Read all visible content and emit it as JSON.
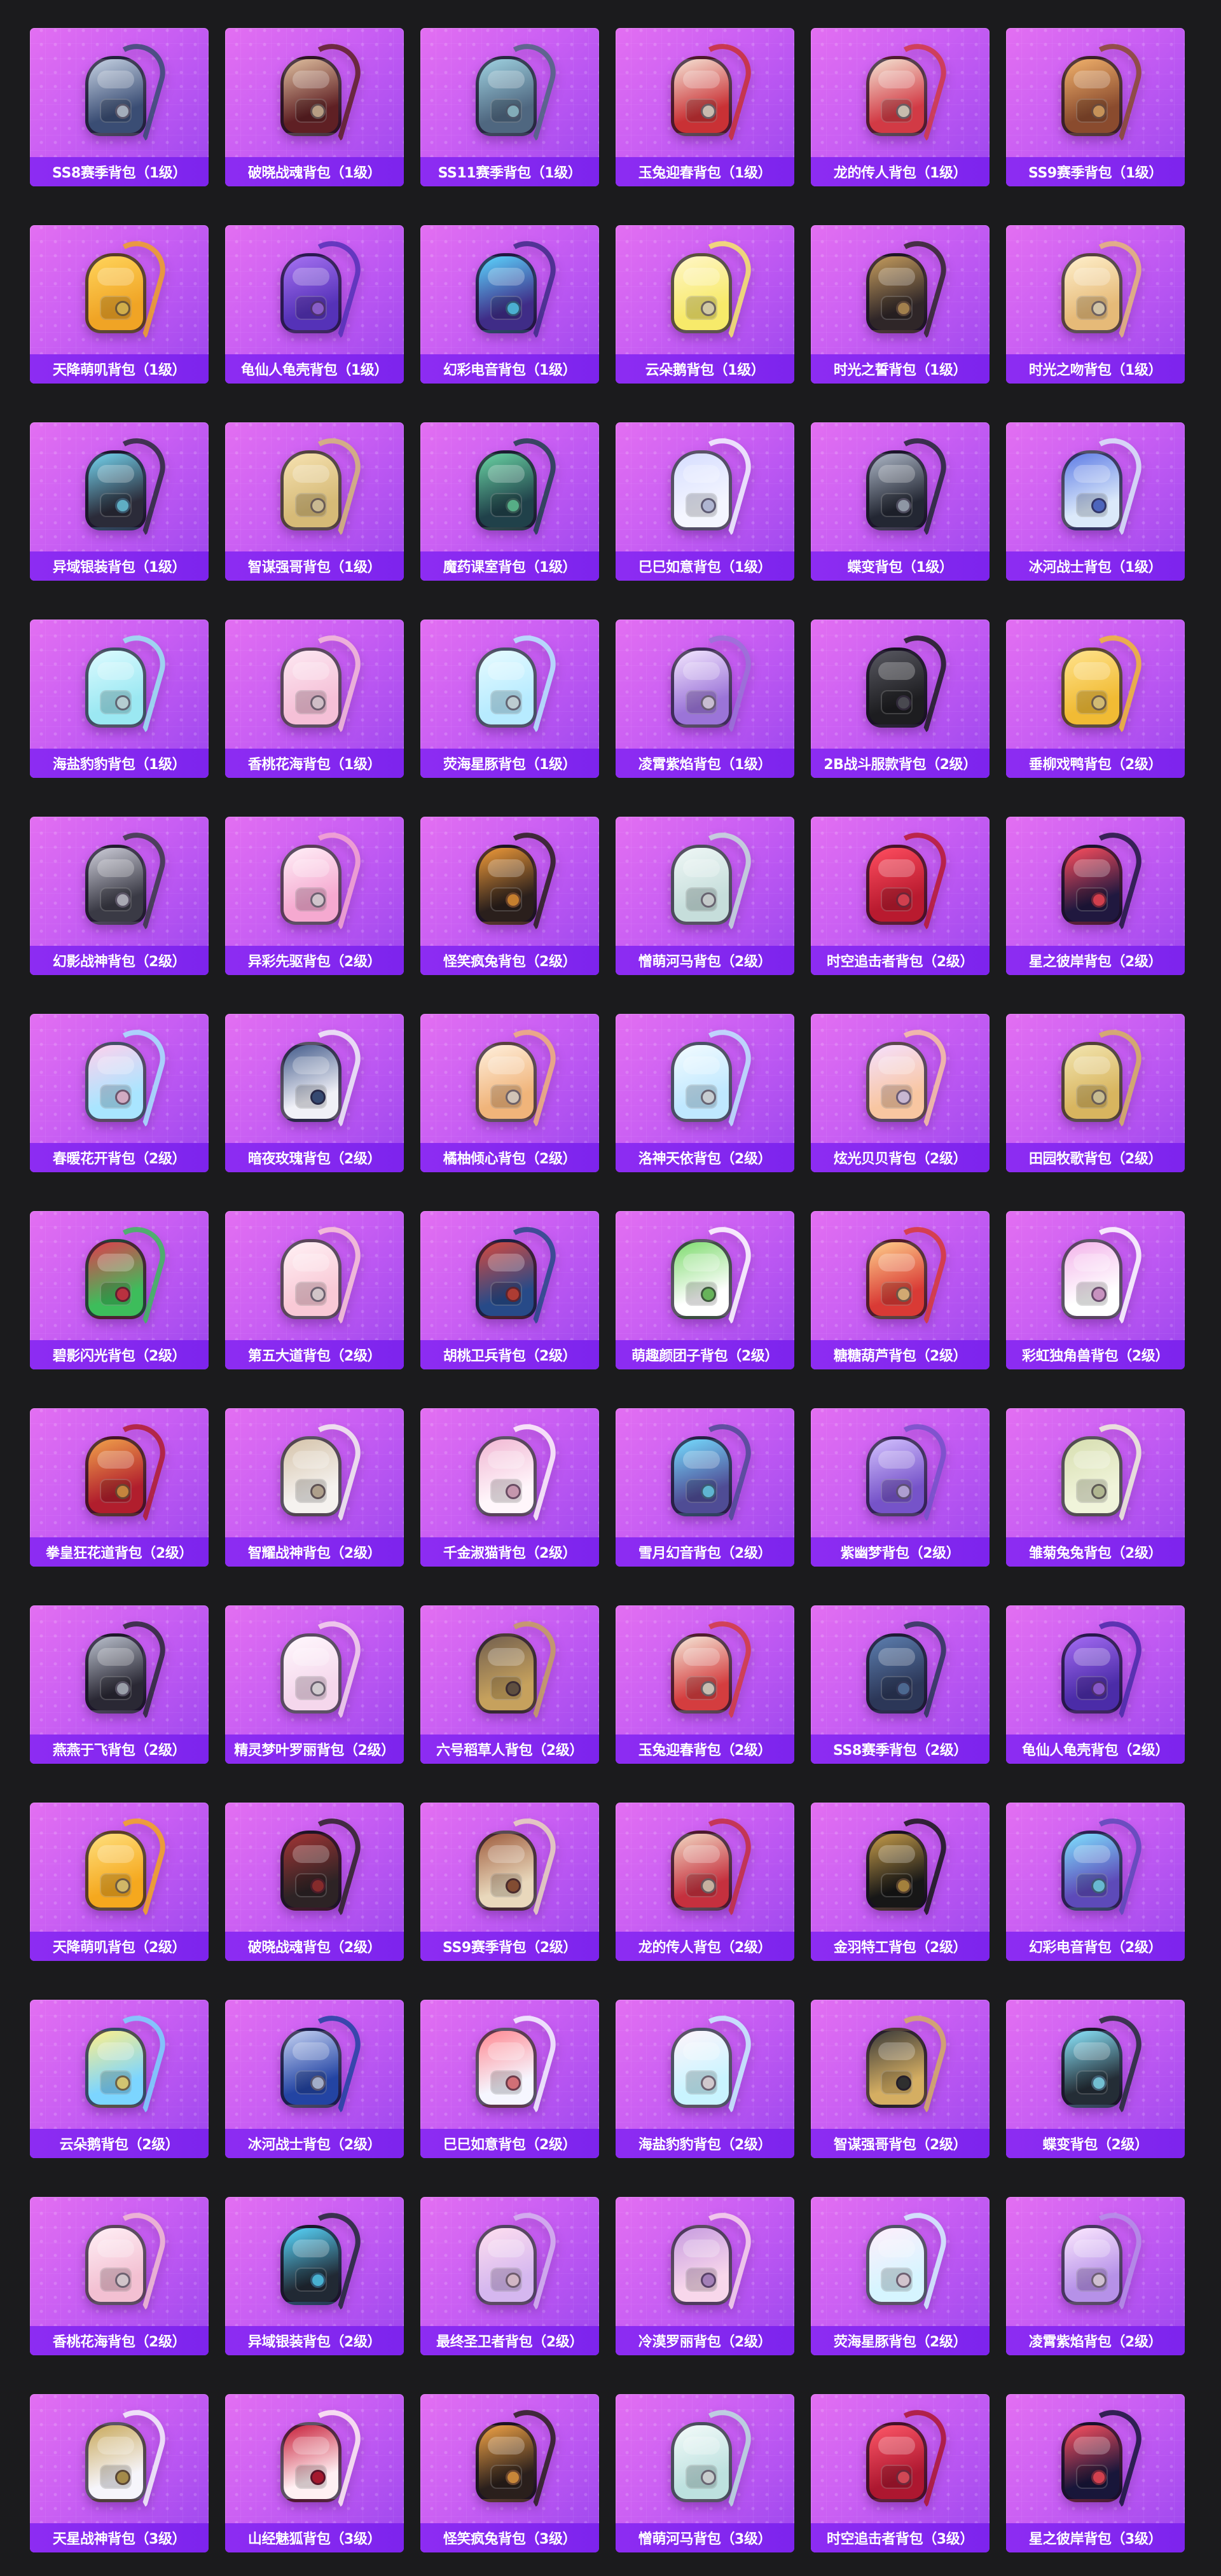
{
  "items": [
    {
      "name": "SS8赛季背包（1级）",
      "icon": "backpack-icon",
      "colors": [
        "#3a4d74",
        "#c7d3e4"
      ]
    },
    {
      "name": "破晓战魂背包（1级）",
      "icon": "backpack-icon",
      "colors": [
        "#5f2024",
        "#e0c0a0"
      ]
    },
    {
      "name": "SS11赛季背包（1级）",
      "icon": "backpack-icon",
      "colors": [
        "#4f6780",
        "#9fd2e1"
      ]
    },
    {
      "name": "玉兔迎春背包（1级）",
      "icon": "backpack-icon",
      "colors": [
        "#c93135",
        "#f6e4d6"
      ]
    },
    {
      "name": "龙的传人背包（1级）",
      "icon": "backpack-icon",
      "colors": [
        "#d23a45",
        "#f4e4d3"
      ]
    },
    {
      "name": "SS9赛季背包（1级）",
      "icon": "backpack-icon",
      "colors": [
        "#8a4b2e",
        "#f2b26c"
      ]
    },
    {
      "name": "天降萌叽背包（1级）",
      "icon": "backpack-icon",
      "colors": [
        "#f0a425",
        "#ffd55c"
      ]
    },
    {
      "name": "龟仙人龟壳背包（1级）",
      "icon": "backpack-icon",
      "colors": [
        "#5532b8",
        "#a772f3"
      ]
    },
    {
      "name": "幻彩电音背包（1级）",
      "icon": "backpack-icon",
      "colors": [
        "#3f2c87",
        "#5cd6ff"
      ]
    },
    {
      "name": "云朵鹅背包（1级）",
      "icon": "backpack-icon",
      "colors": [
        "#f7ea6a",
        "#fff6c8"
      ]
    },
    {
      "name": "时光之誓背包（1级）",
      "icon": "backpack-icon",
      "colors": [
        "#2f2628",
        "#c69d5e"
      ]
    },
    {
      "name": "时光之吻背包（1级）",
      "icon": "backpack-icon",
      "colors": [
        "#e6ba78",
        "#fff0cc"
      ]
    },
    {
      "name": "异域银装背包（1级）",
      "icon": "backpack-icon",
      "colors": [
        "#2b2b39",
        "#74d5f0"
      ]
    },
    {
      "name": "智谋强哥背包（1级）",
      "icon": "backpack-icon",
      "colors": [
        "#d6ba77",
        "#f6e2b1"
      ]
    },
    {
      "name": "魔药课室背包（1级）",
      "icon": "backpack-icon",
      "colors": [
        "#20414a",
        "#6ad4a4"
      ]
    },
    {
      "name": "巳巳如意背包（1级）",
      "icon": "backpack-icon",
      "colors": [
        "#f4f6ff",
        "#d6ddff"
      ]
    },
    {
      "name": "蝶变背包（1级）",
      "icon": "backpack-icon",
      "colors": [
        "#232733",
        "#aeb8c8"
      ]
    },
    {
      "name": "冰河战士背包（1级）",
      "icon": "backpack-icon",
      "colors": [
        "#dbe9fa",
        "#5e7ce6"
      ]
    },
    {
      "name": "海盐豹豹背包（1级）",
      "icon": "backpack-icon",
      "colors": [
        "#9be8f2",
        "#ddfbff"
      ]
    },
    {
      "name": "香桃花海背包（1级）",
      "icon": "backpack-icon",
      "colors": [
        "#f5c0d7",
        "#fde8f2"
      ]
    },
    {
      "name": "荧海星豚背包（1级）",
      "icon": "backpack-icon",
      "colors": [
        "#b7ebff",
        "#e7fbff"
      ]
    },
    {
      "name": "凌霄紫焰背包（1级）",
      "icon": "backpack-icon",
      "colors": [
        "#9b74d8",
        "#f4e7ff"
      ]
    },
    {
      "name": "2B战斗服款背包（2级）",
      "icon": "backpack-icon",
      "colors": [
        "#1d1d20",
        "#595962"
      ]
    },
    {
      "name": "垂柳戏鸭背包（2级）",
      "icon": "backpack-icon",
      "colors": [
        "#f1bb34",
        "#ffe38d"
      ]
    },
    {
      "name": "幻影战神背包（2级）",
      "icon": "backpack-icon",
      "colors": [
        "#3a3a45",
        "#cfcfdb"
      ]
    },
    {
      "name": "异彩先驱背包（2级）",
      "icon": "backpack-icon",
      "colors": [
        "#f5a9d0",
        "#fff0f8"
      ]
    },
    {
      "name": "怪笑疯兔背包（2级）",
      "icon": "backpack-icon",
      "colors": [
        "#2a1f1c",
        "#f19b39"
      ]
    },
    {
      "name": "憎萌河马背包（2级）",
      "icon": "backpack-icon",
      "colors": [
        "#c6dedb",
        "#eff7f6"
      ]
    },
    {
      "name": "时空追击者背包（2级）",
      "icon": "backpack-icon",
      "colors": [
        "#b91a2f",
        "#ff4e60"
      ]
    },
    {
      "name": "星之彼岸背包（2级）",
      "icon": "backpack-icon",
      "colors": [
        "#20183f",
        "#ff4e5e"
      ]
    },
    {
      "name": "春暖花开背包（2级）",
      "icon": "backpack-icon",
      "colors": [
        "#a9e5ff",
        "#ffd1ed"
      ]
    },
    {
      "name": "暗夜玫瑰背包（2级）",
      "icon": "backpack-icon",
      "colors": [
        "#f0f0f7",
        "#425a8a"
      ]
    },
    {
      "name": "橘柚倾心背包（2级）",
      "icon": "backpack-icon",
      "colors": [
        "#f0b47a",
        "#fff0de"
      ]
    },
    {
      "name": "洛神天依背包（2级）",
      "icon": "backpack-icon",
      "colors": [
        "#bfe8ff",
        "#f3fbff"
      ]
    },
    {
      "name": "炫光贝贝背包（2级）",
      "icon": "backpack-icon",
      "colors": [
        "#f8c6a1",
        "#f5e0ff"
      ]
    },
    {
      "name": "田园牧歌背包（2级）",
      "icon": "backpack-icon",
      "colors": [
        "#d8b55f",
        "#f3e6b1"
      ]
    },
    {
      "name": "碧影闪光背包（2级）",
      "icon": "backpack-icon",
      "colors": [
        "#3dbd5b",
        "#e23c4d"
      ]
    },
    {
      "name": "第五大道背包（2级）",
      "icon": "backpack-icon",
      "colors": [
        "#f9c9d6",
        "#fff1f5"
      ]
    },
    {
      "name": "胡桃卫兵背包（2级）",
      "icon": "backpack-icon",
      "colors": [
        "#274a88",
        "#d54a3f"
      ]
    },
    {
      "name": "萌趣颜团子背包（2级）",
      "icon": "backpack-icon",
      "colors": [
        "#ffffff",
        "#7edb6e"
      ]
    },
    {
      "name": "糖糖葫芦背包（2级）",
      "icon": "backpack-icon",
      "colors": [
        "#d93a35",
        "#ffcf8b"
      ]
    },
    {
      "name": "彩虹独角兽背包（2级）",
      "icon": "backpack-icon",
      "colors": [
        "#ffffff",
        "#f3b3ea"
      ]
    },
    {
      "name": "拳皇狂花道背包（2级）",
      "icon": "backpack-icon",
      "colors": [
        "#b11e2d",
        "#f1a24b"
      ]
    },
    {
      "name": "智耀战神背包（2级）",
      "icon": "backpack-icon",
      "colors": [
        "#f5f2ef",
        "#d5c3aa"
      ]
    },
    {
      "name": "千金淑猫背包（2级）",
      "icon": "backpack-icon",
      "colors": [
        "#fff6fb",
        "#f1b7d3"
      ]
    },
    {
      "name": "雪月幻音背包（2级）",
      "icon": "backpack-icon",
      "colors": [
        "#4f4c95",
        "#75ddff"
      ]
    },
    {
      "name": "紫幽梦背包（2级）",
      "icon": "backpack-icon",
      "colors": [
        "#7653c9",
        "#d3c1ff"
      ]
    },
    {
      "name": "雏菊兔兔背包（2级）",
      "icon": "backpack-icon",
      "colors": [
        "#f0f4da",
        "#d7deb0"
      ]
    },
    {
      "name": "燕燕于飞背包（2级）",
      "icon": "backpack-icon",
      "colors": [
        "#2a2834",
        "#bcc2cf"
      ]
    },
    {
      "name": "精灵梦叶罗丽背包（2级）",
      "icon": "backpack-icon",
      "colors": [
        "#f5d7ec",
        "#fff8fd"
      ]
    },
    {
      "name": "六号稻草人背包（2级）",
      "icon": "backpack-icon",
      "colors": [
        "#c6a15d",
        "#73604f"
      ]
    },
    {
      "name": "玉兔迎春背包（2级）",
      "icon": "backpack-icon",
      "colors": [
        "#d43d3f",
        "#f5e8d8"
      ]
    },
    {
      "name": "SS8赛季背包（2级）",
      "icon": "backpack-icon",
      "colors": [
        "#2c3758",
        "#5d7fb0"
      ]
    },
    {
      "name": "龟仙人龟壳背包（2级）",
      "icon": "backpack-icon",
      "colors": [
        "#4b2ca8",
        "#a56cf4"
      ]
    },
    {
      "name": "天降萌叽背包（2级）",
      "icon": "backpack-icon",
      "colors": [
        "#f5a81e",
        "#ffe07e"
      ]
    },
    {
      "name": "破晓战魂背包（2级）",
      "icon": "backpack-icon",
      "colors": [
        "#2d2325",
        "#a33535"
      ]
    },
    {
      "name": "SS9赛季背包（2级）",
      "icon": "backpack-icon",
      "colors": [
        "#e9d8bc",
        "#9f5d3e"
      ]
    },
    {
      "name": "龙的传人背包（2级）",
      "icon": "backpack-icon",
      "colors": [
        "#c5303e",
        "#f2d8c3"
      ]
    },
    {
      "name": "金羽特工背包（2级）",
      "icon": "backpack-icon",
      "colors": [
        "#171717",
        "#c79d4a"
      ]
    },
    {
      "name": "幻彩电音背包（2级）",
      "icon": "backpack-icon",
      "colors": [
        "#5d4ab9",
        "#7fe2ff"
      ]
    },
    {
      "name": "云朵鹅背包（2级）",
      "icon": "backpack-icon",
      "colors": [
        "#7cd5ff",
        "#fff08a"
      ]
    },
    {
      "name": "冰河战士背包（2级）",
      "icon": "backpack-icon",
      "colors": [
        "#2344a3",
        "#c6d3f4"
      ]
    },
    {
      "name": "巳巳如意背包（2级）",
      "icon": "backpack-icon",
      "colors": [
        "#f6f6ff",
        "#ff8891"
      ]
    },
    {
      "name": "海盐豹豹背包（2级）",
      "icon": "backpack-icon",
      "colors": [
        "#c9f4ff",
        "#fff4fb"
      ]
    },
    {
      "name": "智谋强哥背包（2级）",
      "icon": "backpack-icon",
      "colors": [
        "#d5ae62",
        "#3a3a3a"
      ]
    },
    {
      "name": "蝶变背包（2级）",
      "icon": "backpack-icon",
      "colors": [
        "#242d36",
        "#8ce8ff"
      ]
    },
    {
      "name": "香桃花海背包（2级）",
      "icon": "backpack-icon",
      "colors": [
        "#f3c0d2",
        "#fff0f6"
      ]
    },
    {
      "name": "异域银装背包（2级）",
      "icon": "backpack-icon",
      "colors": [
        "#212934",
        "#58d8ff"
      ]
    },
    {
      "name": "最终圣卫者背包（2级）",
      "icon": "backpack-icon",
      "colors": [
        "#d5b7ef",
        "#ffdfef"
      ]
    },
    {
      "name": "冷漠罗丽背包（2级）",
      "icon": "backpack-icon",
      "colors": [
        "#f8d7eb",
        "#c79ce0"
      ]
    },
    {
      "name": "荧海星豚背包（2级）",
      "icon": "backpack-icon",
      "colors": [
        "#d6f5ff",
        "#ffeefb"
      ]
    },
    {
      "name": "凌霄紫焰背包（2级）",
      "icon": "backpack-icon",
      "colors": [
        "#b691e8",
        "#fde9ff"
      ]
    },
    {
      "name": "天星战神背包（3级）",
      "icon": "backpack-icon",
      "colors": [
        "#f6f5fb",
        "#c9a95b"
      ]
    },
    {
      "name": "山经魅狐背包（3级）",
      "icon": "backpack-icon",
      "colors": [
        "#fff0f3",
        "#c81f39"
      ]
    },
    {
      "name": "怪笑疯兔背包（3级）",
      "icon": "backpack-icon",
      "colors": [
        "#2a1f1c",
        "#f3a446"
      ]
    },
    {
      "name": "憎萌河马背包（3级）",
      "icon": "backpack-icon",
      "colors": [
        "#bde1df",
        "#f4fbfa"
      ]
    },
    {
      "name": "时空追击者背包（3级）",
      "icon": "backpack-icon",
      "colors": [
        "#ad1730",
        "#ff5868"
      ]
    },
    {
      "name": "星之彼岸背包（3级）",
      "icon": "backpack-icon",
      "colors": [
        "#18163a",
        "#ff5060"
      ]
    }
  ]
}
